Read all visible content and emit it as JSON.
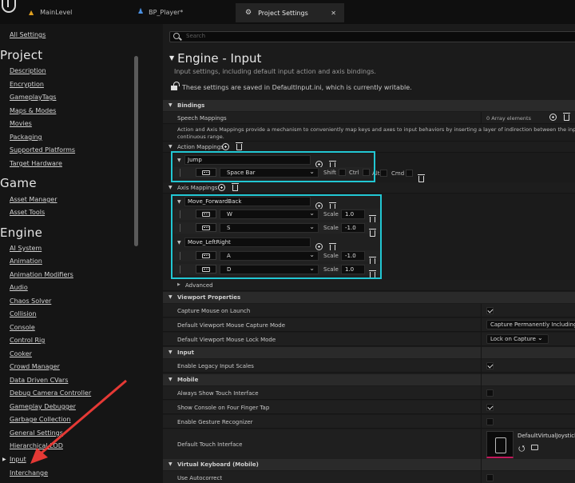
{
  "tabs": [
    {
      "label": "MainLevel"
    },
    {
      "label": "BP_Player*"
    },
    {
      "label": "Project Settings"
    }
  ],
  "sidebar": {
    "all_settings": "All Settings",
    "groups": [
      {
        "title": "Project",
        "items": [
          "Description",
          "Encryption",
          "GameplayTags",
          "Maps & Modes",
          "Movies",
          "Packaging",
          "Supported Platforms",
          "Target Hardware"
        ]
      },
      {
        "title": "Game",
        "items": [
          "Asset Manager",
          "Asset Tools"
        ]
      },
      {
        "title": "Engine",
        "items": [
          "AI System",
          "Animation",
          "Animation Modifiers",
          "Audio",
          "Chaos Solver",
          "Collision",
          "Console",
          "Control Rig",
          "Cooker",
          "Crowd Manager",
          "Data Driven CVars",
          "Debug Camera Controller",
          "Gameplay Debugger",
          "Garbage Collection",
          "General Settings",
          "Hierarchical LOD",
          "Input",
          "Interchange"
        ]
      }
    ]
  },
  "search": {
    "placeholder": "Search"
  },
  "header": {
    "title": "Engine - Input",
    "subtitle": "Input settings, including default input action and axis bindings.",
    "lock_note": "These settings are saved in DefaultInput.ini, which is currently writable."
  },
  "bindings": {
    "section": "Bindings",
    "speech_label": "Speech Mappings",
    "speech_value": "0 Array elements",
    "description": "Action and Axis Mappings provide a mechanism to conveniently map keys and axes to input behaviors by inserting a layer of indirection between the input b",
    "description2": "continuous range.",
    "action_label": "Action Mappings",
    "action": {
      "name": "Jump",
      "key": "Space Bar",
      "mods": [
        "Shift",
        "Ctrl",
        "Alt",
        "Cmd"
      ]
    },
    "axis_label": "Axis Mappings",
    "scale_label": "Scale",
    "axes": [
      {
        "name": "Move_ForwardBack",
        "keys": [
          {
            "key": "W",
            "scale": "1.0"
          },
          {
            "key": "S",
            "scale": "-1.0"
          }
        ]
      },
      {
        "name": "Move_LeftRight",
        "keys": [
          {
            "key": "A",
            "scale": "-1.0"
          },
          {
            "key": "D",
            "scale": "1.0"
          }
        ]
      }
    ],
    "advanced": "Advanced"
  },
  "viewport": {
    "section": "Viewport Properties",
    "capture_launch": "Capture Mouse on Launch",
    "capture_mode_label": "Default Viewport Mouse Capture Mode",
    "capture_mode_value": "Capture Permanently Including In",
    "lock_mode_label": "Default Viewport Mouse Lock Mode",
    "lock_mode_value": "Lock on Capture"
  },
  "input": {
    "section": "Input",
    "legacy": "Enable Legacy Input Scales"
  },
  "mobile": {
    "section": "Mobile",
    "always_touch": "Always Show Touch Interface",
    "four_finger": "Show Console on Four Finger Tap",
    "gesture": "Enable Gesture Recognizer",
    "touch_interface": "Default Touch Interface",
    "touch_asset": "DefaultVirtualJoystick"
  },
  "vkeyboard": {
    "section": "Virtual Keyboard (Mobile)",
    "autocorrect": "Use Autocorrect"
  },
  "colors": {
    "highlight": "#22c7d3",
    "arrow": "#e53935",
    "accent": "#c2185b"
  }
}
